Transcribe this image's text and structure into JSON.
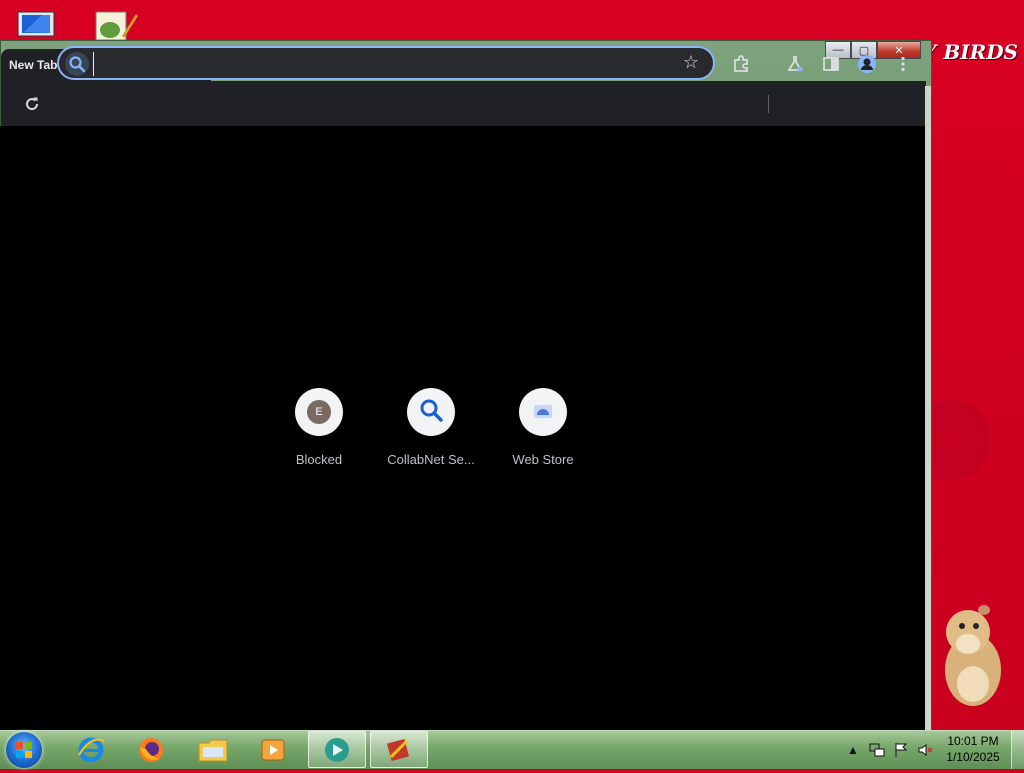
{
  "desktop": {
    "wallpaper_text": "'Y BIRDS",
    "icons": [
      {
        "name": "computer-icon"
      },
      {
        "name": "notepad-icon"
      }
    ]
  },
  "window_controls": {
    "minimize": "—",
    "maximize": "▢",
    "close": "✕"
  },
  "browser": {
    "tab": {
      "title": "New Tab",
      "close_glyph": "✕"
    },
    "new_tab_glyph": "+",
    "omnibox": {
      "value": "",
      "placeholder": ""
    },
    "toolbar_icons": [
      "reload-icon",
      "star-icon",
      "extensions-icon",
      "labs-icon",
      "side-panel-icon",
      "profile-icon",
      "menu-icon"
    ]
  },
  "shortcuts": [
    {
      "label": "Blocked",
      "letter": "E",
      "icon": "letter-e-icon"
    },
    {
      "label": "CollabNet Se...",
      "icon": "search-icon"
    },
    {
      "label": "Web Store",
      "icon": "web-store-icon"
    }
  ],
  "taskbar": {
    "apps": [
      "internet-explorer-icon",
      "firefox-icon",
      "file-explorer-icon",
      "media-player-icon",
      "active-app-icon",
      "winamp-icon"
    ],
    "clock": {
      "time": "10:01 PM",
      "date": "1/10/2025"
    },
    "tray": [
      "show-hidden-icons",
      "network-icon",
      "action-center-flag-icon",
      "volume-muted-icon"
    ]
  }
}
